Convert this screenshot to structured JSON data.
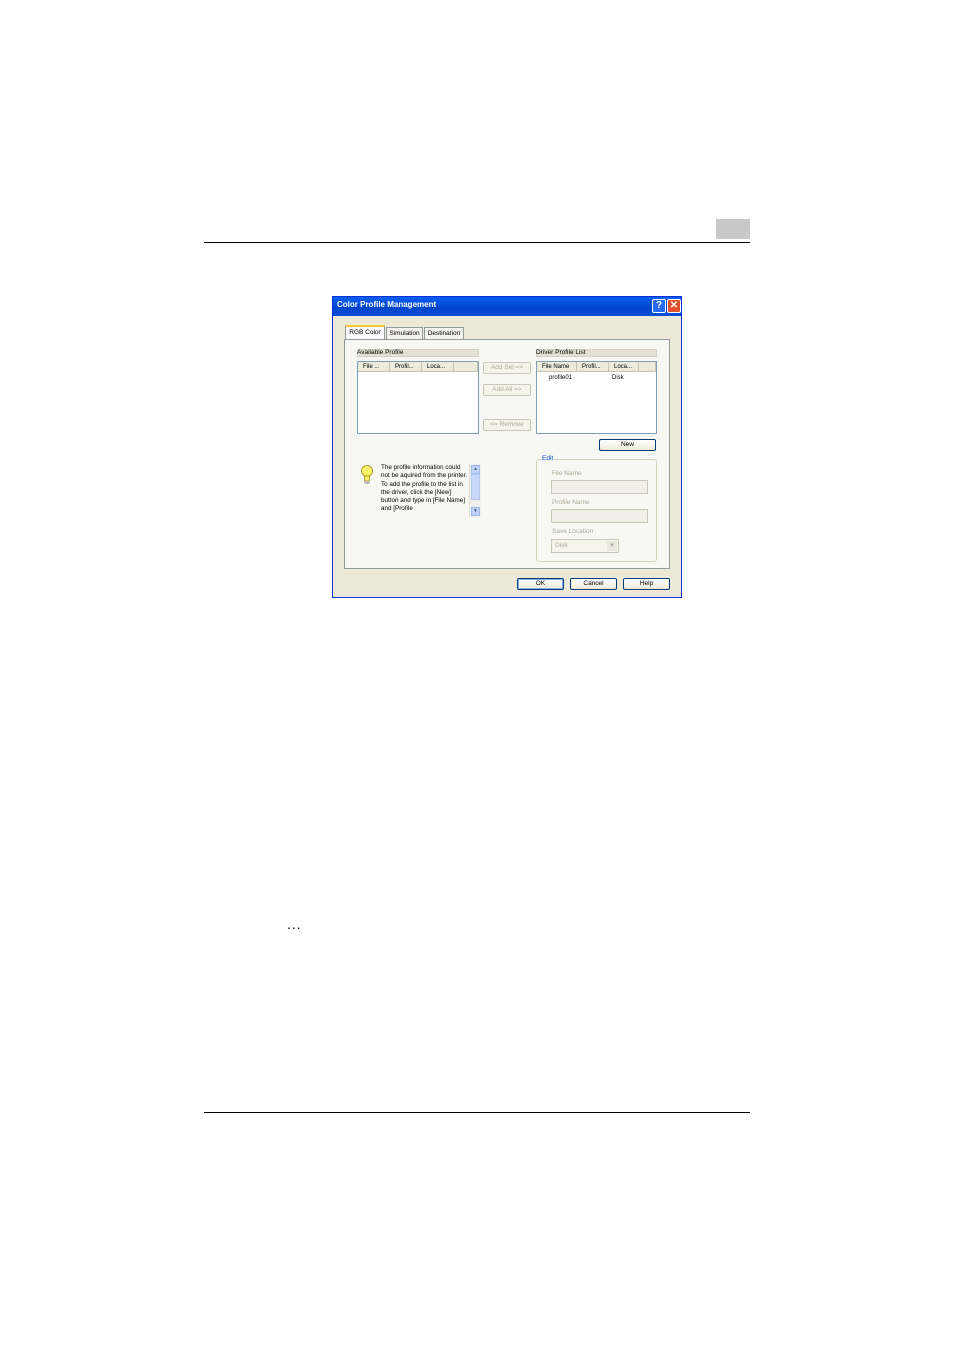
{
  "dialog": {
    "title": "Color Profile Management",
    "help_glyph": "?",
    "close_glyph": "✕",
    "tabs": [
      {
        "label": "RGB Color"
      },
      {
        "label": "Simulation"
      },
      {
        "label": "Destination"
      }
    ],
    "available": {
      "label": "Available Profile",
      "columns": [
        "File ...",
        "Profil...",
        "Loca..."
      ]
    },
    "driver": {
      "label": "Driver Profile List",
      "columns": [
        "File Name",
        "Profil...",
        "Loca..."
      ],
      "rows": [
        {
          "file_name": "profile01",
          "profile": "",
          "location": "Disk"
        }
      ]
    },
    "transfer": {
      "add_sel": "Add Sel =>",
      "add_all": "Add All =>",
      "remove": "<= Remove"
    },
    "new_button": "New",
    "info_text": "The profile information could not be aquired from the printer.  To add the profile to the list in the driver, click the [New] button and type in [File Name] and [Profile",
    "edit": {
      "title": "Edit",
      "file_name_label": "File Name",
      "profile_name_label": "Profile Name",
      "save_location_label": "Save Location",
      "save_location_value": "Disk"
    },
    "buttons": {
      "ok": "OK",
      "cancel": "Cancel",
      "help": "Help"
    }
  },
  "page": {
    "ellipsis": "..."
  }
}
